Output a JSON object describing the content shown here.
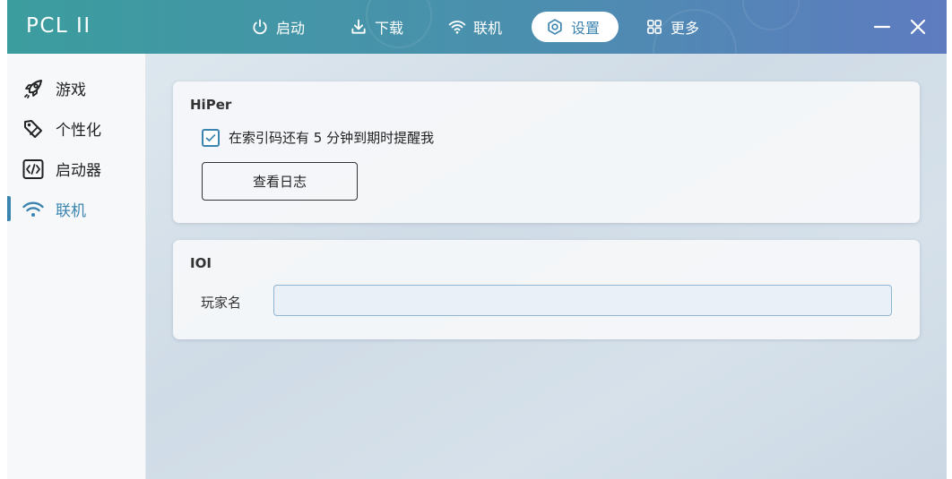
{
  "app": {
    "title": "PCL II"
  },
  "nav": {
    "items": [
      {
        "label": "启动",
        "icon": "power-icon"
      },
      {
        "label": "下载",
        "icon": "download-icon"
      },
      {
        "label": "联机",
        "icon": "wifi-icon"
      },
      {
        "label": "设置",
        "icon": "settings-icon",
        "active": true
      },
      {
        "label": "更多",
        "icon": "grid-icon"
      }
    ]
  },
  "window_controls": {
    "minimize_icon": "minimize-icon",
    "close_icon": "close-icon"
  },
  "sidebar": {
    "items": [
      {
        "label": "游戏",
        "icon": "rocket-icon"
      },
      {
        "label": "个性化",
        "icon": "palette-icon"
      },
      {
        "label": "启动器",
        "icon": "code-icon"
      },
      {
        "label": "联机",
        "icon": "wifi-icon",
        "active": true
      }
    ]
  },
  "hiper": {
    "title": "HiPer",
    "reminder_label": "在索引码还有 5 分钟到期时提醒我",
    "reminder_checked": true,
    "view_log_label": "查看日志"
  },
  "ioi": {
    "title": "IOI",
    "player_name_label": "玩家名",
    "player_name_value": "",
    "player_name_placeholder": ""
  },
  "colors": {
    "accent": "#3c84b0",
    "titlebar_start": "#3b9d9e",
    "titlebar_end": "#5e7bc0"
  }
}
